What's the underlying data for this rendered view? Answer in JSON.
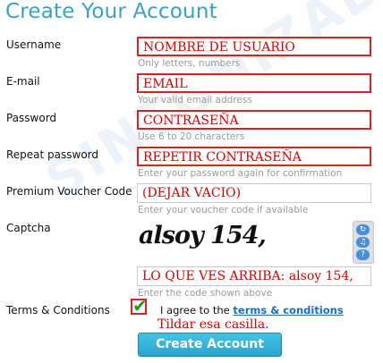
{
  "page": {
    "title": "Create Your Account"
  },
  "watermark": "SINTONIZADOR",
  "fields": [
    {
      "label": "Username",
      "value": "NOMBRE DE USUARIO",
      "hint": "Only letters, numbers"
    },
    {
      "label": "E-mail",
      "value": "EMAIL",
      "hint": "Your valid email address"
    },
    {
      "label": "Password",
      "value": "CONTRASEÑA",
      "hint": "Use 6 to 20 characters"
    },
    {
      "label": "Repeat password",
      "value": "REPETIR CONTRASEÑA",
      "hint": "Enter your password again for confirmation"
    },
    {
      "label": "Premium Voucher Code",
      "value": "(DEJAR VACIO)",
      "hint": "Enter your voucher code if available"
    }
  ],
  "captcha": {
    "label": "Captcha",
    "image_text": "alsoy 154,",
    "value": "LO QUE VES ARRIBA: alsoy 154,",
    "hint": "Enter the code shown above",
    "buttons": [
      "refresh-icon",
      "audio-icon",
      "help-icon"
    ]
  },
  "terms": {
    "label": "Terms & Conditions",
    "agree_prefix": "I agree to the ",
    "agree_link": "terms & conditions",
    "checked": true,
    "note": "Tildar esa casilla."
  },
  "submit_label": "Create Account",
  "colors": {
    "accent": "#3aa0c8",
    "annotation_red": "#d40000",
    "button": "#2aa4cf"
  }
}
